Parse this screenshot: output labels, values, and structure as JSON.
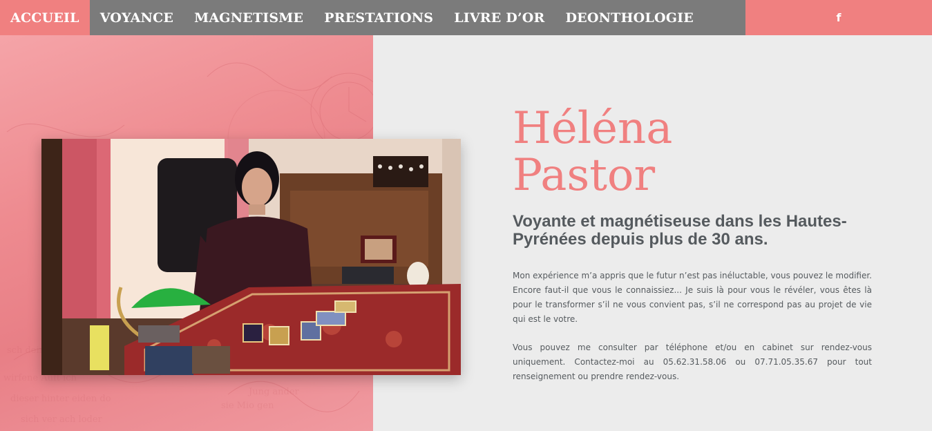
{
  "nav": {
    "items": [
      {
        "label": "ACCUEIL",
        "active": true
      },
      {
        "label": "VOYANCE",
        "active": false
      },
      {
        "label": "MAGNETISME",
        "active": false
      },
      {
        "label": "PRESTATIONS",
        "active": false
      },
      {
        "label": "LIVRE D’OR",
        "active": false
      },
      {
        "label": "DEONTHOLOGIE",
        "active": false
      }
    ],
    "facebook_icon": "f"
  },
  "hero": {
    "title_line1": "Héléna",
    "title_line2": "Pastor",
    "subtitle": "Voyante et magnétiseuse dans les Hautes-Pyrénées depuis plus de 30 ans.",
    "paragraph1": "Mon expérience m’a appris que le futur n’est pas inéluctable, vous pouvez le modifier. Encore faut-il que vous le connaissiez... Je suis là pour vous le révéler, vous êtes là pour le transformer s’il ne vous convient pas, s’il ne correspond pas au projet de vie qui est le votre.",
    "paragraph2": "Vous pouvez me consulter par téléphone et/ou en cabinet sur rendez-vous uniquement. Contactez-moi au 05.62.31.58.06 ou 07.71.05.35.67 pour tout renseignement ou prendre rendez-vous."
  },
  "colors": {
    "accent": "#f08080",
    "nav_bg": "#7b7b7b",
    "text": "#555a5e",
    "background": "#ececec"
  }
}
